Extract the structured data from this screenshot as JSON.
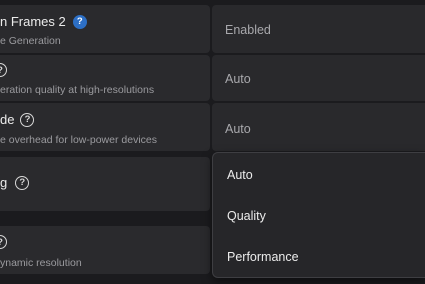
{
  "settings": [
    {
      "title": "n Frames 2",
      "subtitle": "e Generation",
      "value": "Enabled",
      "help_icon": "question-circle-blue"
    },
    {
      "title": "",
      "subtitle": "eration quality at high-resolutions",
      "value": "Auto",
      "help_icon": "question-circle"
    },
    {
      "title": "de",
      "subtitle": "e overhead for low-power devices",
      "value": "Auto",
      "help_icon": "question-circle"
    },
    {
      "title": "g",
      "subtitle": "",
      "value": "",
      "help_icon": "question-circle"
    },
    {
      "title": "",
      "subtitle": "ynamic resolution",
      "value": "",
      "help_icon": "question-circle"
    }
  ],
  "dropdown": {
    "options": [
      "Auto",
      "Quality",
      "Performance"
    ]
  },
  "colors": {
    "accent": "#2d6fc5",
    "background": "#1b1b1e",
    "panel": "#2a2a2d"
  }
}
